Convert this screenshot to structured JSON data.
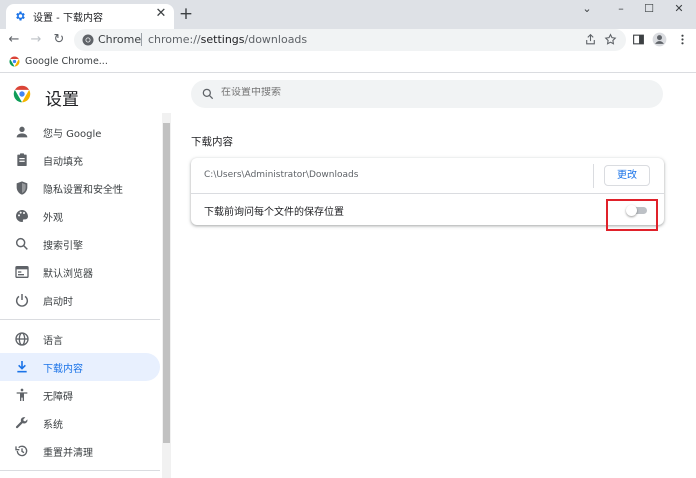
{
  "browser": {
    "tab": {
      "title": "设置 - 下载内容",
      "close_glyph": "✕"
    },
    "new_tab_glyph": "+",
    "window_controls": {
      "minimize": "–",
      "maximize": "☐",
      "close": "✕",
      "menu": "⌄"
    },
    "nav": {
      "back": "←",
      "forward": "→",
      "reload": "↻"
    },
    "omnibox": {
      "site_label": "Chrome",
      "url_prefix": "chrome://",
      "url_host": "settings",
      "url_path": "/downloads"
    },
    "bookmarks": [
      {
        "label": "Google Chrome..."
      }
    ],
    "colors": {
      "accent": "#1a73e8",
      "highlight": "#e0212a",
      "active_bg": "#e8f0fe"
    }
  },
  "settings": {
    "title": "设置",
    "search_placeholder": "在设置中搜索",
    "sidebar": [
      {
        "label": "您与 Google",
        "icon": "person-icon"
      },
      {
        "label": "自动填充",
        "icon": "clipboard-icon"
      },
      {
        "label": "隐私设置和安全性",
        "icon": "shield-icon"
      },
      {
        "label": "外观",
        "icon": "palette-icon"
      },
      {
        "label": "搜索引擎",
        "icon": "search-icon"
      },
      {
        "label": "默认浏览器",
        "icon": "browser-icon"
      },
      {
        "label": "启动时",
        "icon": "power-icon"
      },
      {
        "label": "语言",
        "icon": "globe-icon"
      },
      {
        "label": "下载内容",
        "icon": "download-icon",
        "active": true
      },
      {
        "label": "无障碍",
        "icon": "accessibility-icon"
      },
      {
        "label": "系统",
        "icon": "wrench-icon"
      },
      {
        "label": "重置并清理",
        "icon": "history-icon"
      }
    ],
    "downloads": {
      "section_title": "下载内容",
      "location_path": "C:\\Users\\Administrator\\Downloads",
      "change_button": "更改",
      "ask_label": "下载前询问每个文件的保存位置",
      "ask_enabled": false
    }
  }
}
